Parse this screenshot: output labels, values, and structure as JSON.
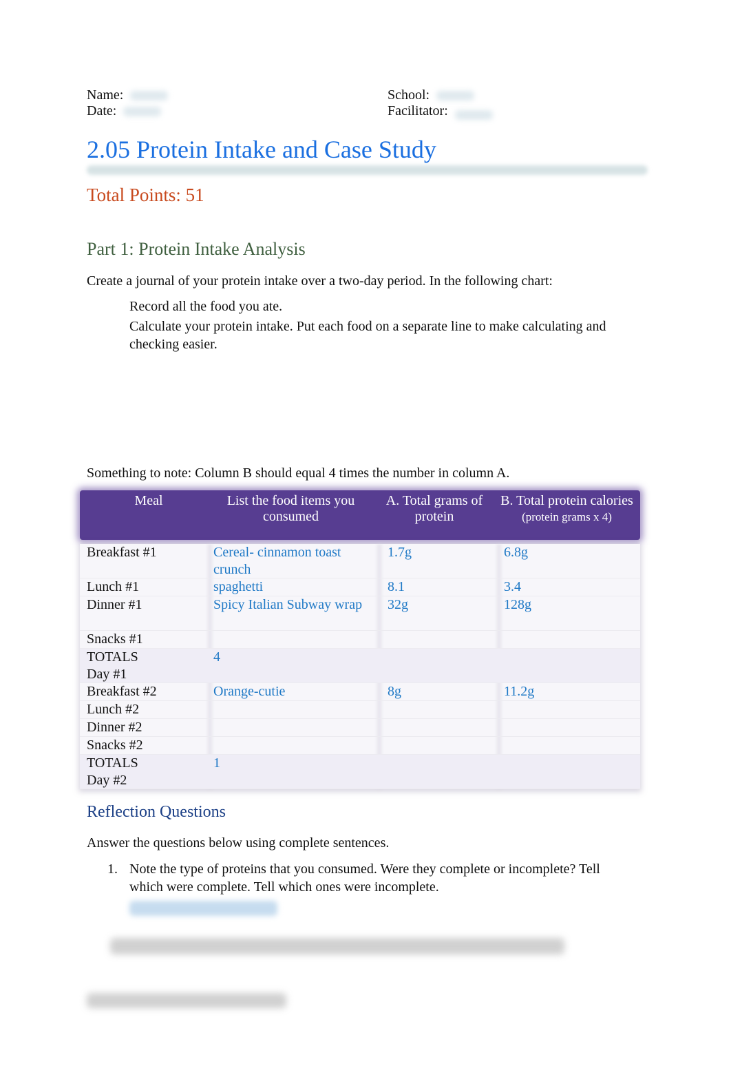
{
  "header": {
    "name_label": "Name:",
    "date_label": "Date:",
    "school_label": "School:",
    "facilitator_label": "Facilitator:"
  },
  "title": "2.05 Protein Intake and Case Study",
  "total_points": "Total Points: 51",
  "part1": {
    "heading": "Part 1: Protein Intake Analysis",
    "intro": "Create a journal of your protein intake over a two-day period. In the following chart:",
    "bullet_glyph": "",
    "bullets": [
      "Record all the food you ate.",
      "Calculate your protein intake. Put each food on a separate line to make calculating and checking easier."
    ],
    "note": "Something to note: Column B should equal 4 times the number in column A."
  },
  "table": {
    "headers": [
      "Meal",
      "List the food items you consumed",
      "A. Total grams of protein",
      "B. Total protein calories"
    ],
    "header_sub": "(protein grams x 4)",
    "rows": [
      {
        "meal": "Breakfast #1",
        "food": "Cereal- cinnamon toast crunch",
        "grams": "1.7g",
        "calories": "6.8g"
      },
      {
        "meal": "Lunch #1",
        "food": "spaghetti",
        "grams": "8.1",
        "calories": "3.4"
      },
      {
        "meal": "Dinner #1",
        "food": "Spicy Italian Subway wrap",
        "grams": "32g",
        "calories": "128g"
      },
      {
        "meal": "Snacks #1",
        "food": "",
        "grams": "",
        "calories": ""
      },
      {
        "meal": "TOTALS Day #1",
        "food": "4",
        "grams": "",
        "calories": ""
      },
      {
        "meal": "Breakfast #2",
        "food": "Orange-cutie",
        "grams": "8g",
        "calories": "11.2g"
      },
      {
        "meal": "Lunch #2",
        "food": "",
        "grams": "",
        "calories": ""
      },
      {
        "meal": "Dinner #2",
        "food": "",
        "grams": "",
        "calories": ""
      },
      {
        "meal": "Snacks #2",
        "food": "",
        "grams": "",
        "calories": ""
      },
      {
        "meal": "TOTALS Day #2",
        "food": "1",
        "grams": "",
        "calories": ""
      }
    ]
  },
  "reflection": {
    "heading": "Reflection Questions",
    "intro": "Answer the questions below using complete sentences.",
    "questions": [
      {
        "number": "1.",
        "text": "Note the type of proteins that you consumed. Were they complete or incomplete? Tell which were complete. Tell which ones were incomplete."
      }
    ]
  },
  "colors": {
    "title": "#1a6fe0",
    "points": "#c84a1e",
    "part_heading": "#3f5f3f",
    "table_header": "#573d91",
    "answer_text": "#1f79c6",
    "reflection_heading": "#1b3f86"
  }
}
